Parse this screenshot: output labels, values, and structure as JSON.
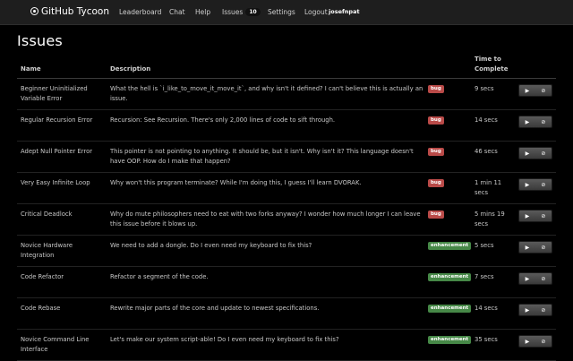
{
  "app": {
    "title": "GitHub Tycoon"
  },
  "nav": {
    "leaderboard": "Leaderboard",
    "chat": "Chat",
    "help": "Help",
    "issues": "Issues",
    "issues_count": "10",
    "settings": "Settings",
    "logout": "Logout",
    "user": "josefnpat"
  },
  "page": {
    "title": "Issues"
  },
  "table": {
    "headers": {
      "name": "Name",
      "description": "Description",
      "time": "Time to Complete"
    },
    "rows": [
      {
        "name": "Beginner Uninitialized Variable Error",
        "description": "What the hell is `i_like_to_move_it_move_it`, and why isn't it defined? I can't believe this is actually an issue.",
        "tag": "bug",
        "time": "9 secs"
      },
      {
        "name": "Regular Recursion Error",
        "description": "Recursion: See Recursion. There's only 2,000 lines of code to sift through.",
        "tag": "bug",
        "time": "14 secs"
      },
      {
        "name": "Adept Null Pointer Error",
        "description": "This pointer is not pointing to anything. It should be, but it isn't. Why isn't it? This language doesn't have OOP. How do I make that happen?",
        "tag": "bug",
        "time": "46 secs"
      },
      {
        "name": "Very Easy Infinite Loop",
        "description": "Why won't this program terminate? While I'm doing this, I guess I'll learn DVORAK.",
        "tag": "bug",
        "time": "1 min 11 secs"
      },
      {
        "name": "Critical Deadlock",
        "description": "Why do mute philosophers need to eat with two forks anyway? I wonder how much longer I can leave this issue before it blows up.",
        "tag": "bug",
        "time": "5 mins 19 secs"
      },
      {
        "name": "Novice Hardware Integration",
        "description": "We need to add a dongle. Do I even need my keyboard to fix this?",
        "tag": "enhancement",
        "time": "5 secs"
      },
      {
        "name": "Code Refactor",
        "description": "Refactor a segment of the code.",
        "tag": "enhancement",
        "time": "7 secs"
      },
      {
        "name": "Code Rebase",
        "description": "Rewrite major parts of the core and update to newest specifications.",
        "tag": "enhancement",
        "time": "14 secs"
      },
      {
        "name": "Novice Command Line Interface",
        "description": "Let's make our system script-able! Do I even need my keyboard to fix this?",
        "tag": "enhancement",
        "time": "35 secs"
      }
    ]
  },
  "actions": {
    "play_icon": "▶",
    "cancel_icon": "⊘"
  }
}
